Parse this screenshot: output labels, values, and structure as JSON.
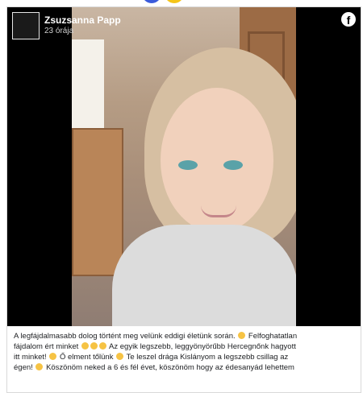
{
  "post": {
    "author": "Zsuzsanna Papp",
    "time": "23 órája",
    "network_icon": "facebook-icon",
    "caption_lines": [
      "A legfájdalmasabb dolog történt meg velünk eddigi életünk során.",
      "Felfoghatatlan",
      "fájdalom ért minket",
      "Az egyik legszebb, leggyönyörűbb Hercegnőnk hagyott",
      "itt minket!",
      "Ő elment tőlünk",
      "Te leszel drága Kislányom a legszebb csillag az",
      "égen!",
      "Köszönöm neked a 6 és fél évet, köszönöm hogy az édesanyád lehettem"
    ]
  }
}
